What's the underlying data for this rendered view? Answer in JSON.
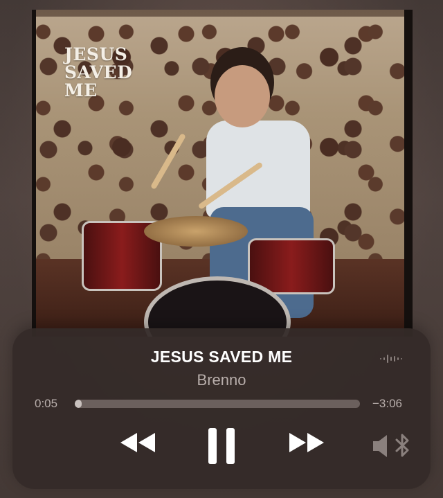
{
  "album": {
    "cover_title": "JESUS\nSAVED\nME"
  },
  "now_playing": {
    "title": "JESUS SAVED ME",
    "artist": "Brenno",
    "elapsed": "0:05",
    "remaining": "−3:06",
    "progress_fraction": 0.025
  },
  "controls": {
    "rewind_icon": "backward-icon",
    "pause_icon": "pause-icon",
    "forward_icon": "forward-icon",
    "audio_output_icon": "speaker-bluetooth-icon",
    "waveform_icon": "waveform-icon"
  },
  "colors": {
    "player_bg": "#342a28",
    "text_primary": "#ffffff",
    "text_secondary": "#b8aeab",
    "progress_track": "#6b605d",
    "progress_fill": "#c9c1be"
  }
}
